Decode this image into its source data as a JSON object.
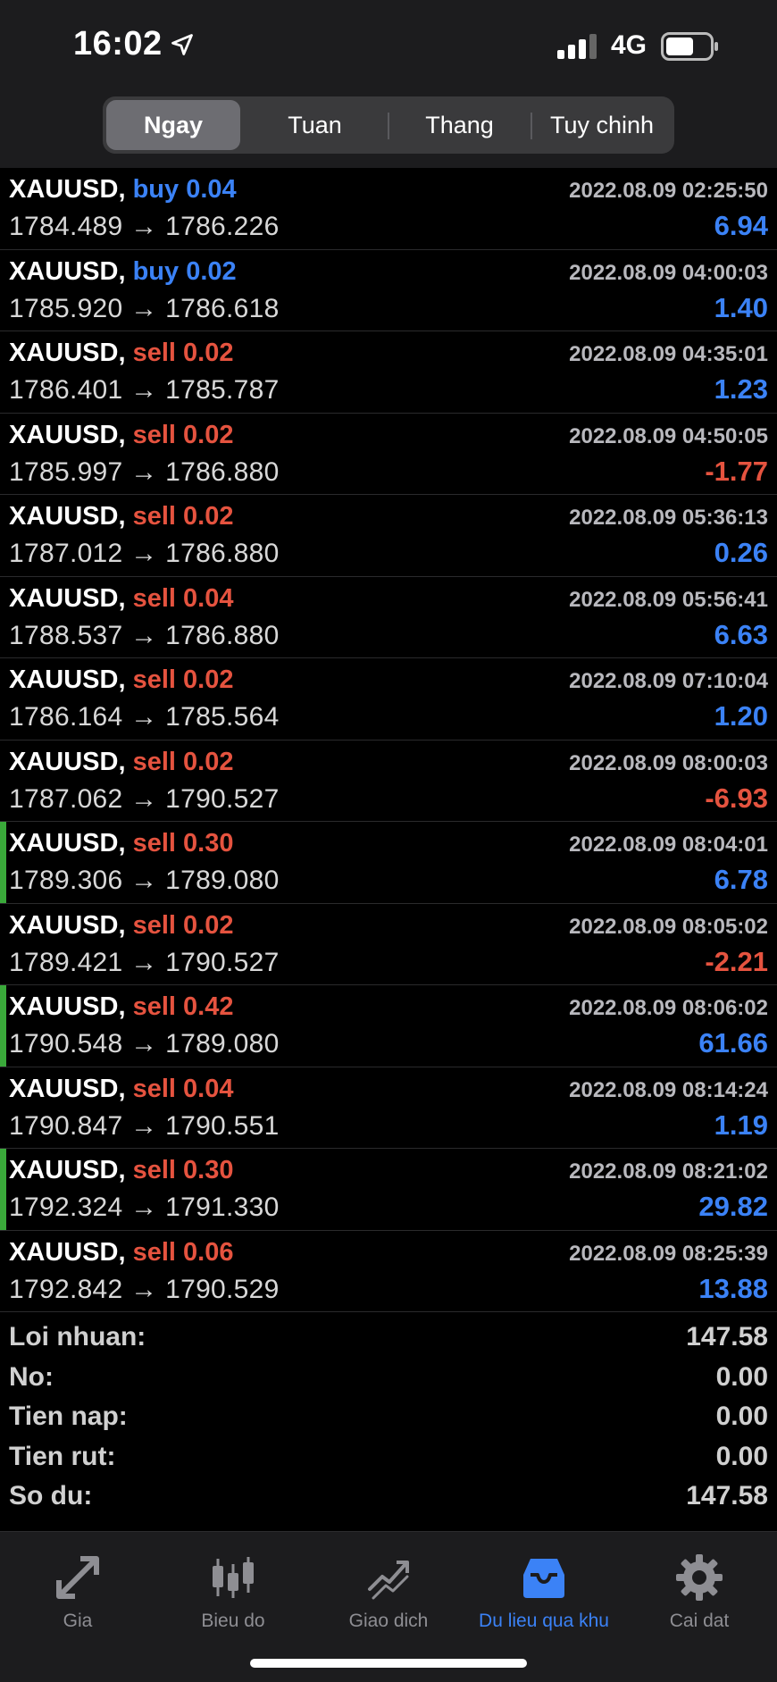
{
  "status_bar": {
    "time": "16:02",
    "network": "4G"
  },
  "tabs": [
    {
      "label": "Ngay",
      "active": true
    },
    {
      "label": "Tuan",
      "active": false
    },
    {
      "label": "Thang",
      "active": false
    },
    {
      "label": "Tuy chinh",
      "active": false
    }
  ],
  "trades": [
    {
      "symbol": "XAUUSD,",
      "side": "buy 0.04",
      "type": "buy",
      "prices": "1784.489 → 1786.226",
      "time": "2022.08.09 02:25:50",
      "profit": "6.94",
      "sign": "pos",
      "highlight": false
    },
    {
      "symbol": "XAUUSD,",
      "side": "buy 0.02",
      "type": "buy",
      "prices": "1785.920 → 1786.618",
      "time": "2022.08.09 04:00:03",
      "profit": "1.40",
      "sign": "pos",
      "highlight": false
    },
    {
      "symbol": "XAUUSD,",
      "side": "sell 0.02",
      "type": "sell",
      "prices": "1786.401 → 1785.787",
      "time": "2022.08.09 04:35:01",
      "profit": "1.23",
      "sign": "pos",
      "highlight": false
    },
    {
      "symbol": "XAUUSD,",
      "side": "sell 0.02",
      "type": "sell",
      "prices": "1785.997 → 1786.880",
      "time": "2022.08.09 04:50:05",
      "profit": "-1.77",
      "sign": "neg",
      "highlight": false
    },
    {
      "symbol": "XAUUSD,",
      "side": "sell 0.02",
      "type": "sell",
      "prices": "1787.012 → 1786.880",
      "time": "2022.08.09 05:36:13",
      "profit": "0.26",
      "sign": "pos",
      "highlight": false
    },
    {
      "symbol": "XAUUSD,",
      "side": "sell 0.04",
      "type": "sell",
      "prices": "1788.537 → 1786.880",
      "time": "2022.08.09 05:56:41",
      "profit": "6.63",
      "sign": "pos",
      "highlight": false
    },
    {
      "symbol": "XAUUSD,",
      "side": "sell 0.02",
      "type": "sell",
      "prices": "1786.164 → 1785.564",
      "time": "2022.08.09 07:10:04",
      "profit": "1.20",
      "sign": "pos",
      "highlight": false
    },
    {
      "symbol": "XAUUSD,",
      "side": "sell 0.02",
      "type": "sell",
      "prices": "1787.062 → 1790.527",
      "time": "2022.08.09 08:00:03",
      "profit": "-6.93",
      "sign": "neg",
      "highlight": false
    },
    {
      "symbol": "XAUUSD,",
      "side": "sell 0.30",
      "type": "sell",
      "prices": "1789.306 → 1789.080",
      "time": "2022.08.09 08:04:01",
      "profit": "6.78",
      "sign": "pos",
      "highlight": true
    },
    {
      "symbol": "XAUUSD,",
      "side": "sell 0.02",
      "type": "sell",
      "prices": "1789.421 → 1790.527",
      "time": "2022.08.09 08:05:02",
      "profit": "-2.21",
      "sign": "neg",
      "highlight": false
    },
    {
      "symbol": "XAUUSD,",
      "side": "sell 0.42",
      "type": "sell",
      "prices": "1790.548 → 1789.080",
      "time": "2022.08.09 08:06:02",
      "profit": "61.66",
      "sign": "pos",
      "highlight": true
    },
    {
      "symbol": "XAUUSD,",
      "side": "sell 0.04",
      "type": "sell",
      "prices": "1790.847 → 1790.551",
      "time": "2022.08.09 08:14:24",
      "profit": "1.19",
      "sign": "pos",
      "highlight": false
    },
    {
      "symbol": "XAUUSD,",
      "side": "sell 0.30",
      "type": "sell",
      "prices": "1792.324 → 1791.330",
      "time": "2022.08.09 08:21:02",
      "profit": "29.82",
      "sign": "pos",
      "highlight": true
    },
    {
      "symbol": "XAUUSD,",
      "side": "sell 0.06",
      "type": "sell",
      "prices": "1792.842 → 1790.529",
      "time": "2022.08.09 08:25:39",
      "profit": "13.88",
      "sign": "pos",
      "highlight": false
    }
  ],
  "summary": [
    {
      "label": "Loi nhuan:",
      "value": "147.58"
    },
    {
      "label": "No:",
      "value": "0.00"
    },
    {
      "label": "Tien nap:",
      "value": "0.00"
    },
    {
      "label": "Tien rut:",
      "value": "0.00"
    },
    {
      "label": "So du:",
      "value": "147.58"
    }
  ],
  "bottom_nav": [
    {
      "label": "Gia",
      "icon": "quotes-arrows-icon",
      "active": false
    },
    {
      "label": "Bieu do",
      "icon": "candlestick-chart-icon",
      "active": false
    },
    {
      "label": "Giao dich",
      "icon": "trade-trend-icon",
      "active": false
    },
    {
      "label": "Du lieu qua khu",
      "icon": "history-inbox-icon",
      "active": true
    },
    {
      "label": "Cai dat",
      "icon": "gear-icon",
      "active": false
    }
  ],
  "colors": {
    "buy": "#3b82f6",
    "sell": "#e5533f",
    "highlight": "#3aa93a",
    "active_tab": "#3b82f6"
  }
}
